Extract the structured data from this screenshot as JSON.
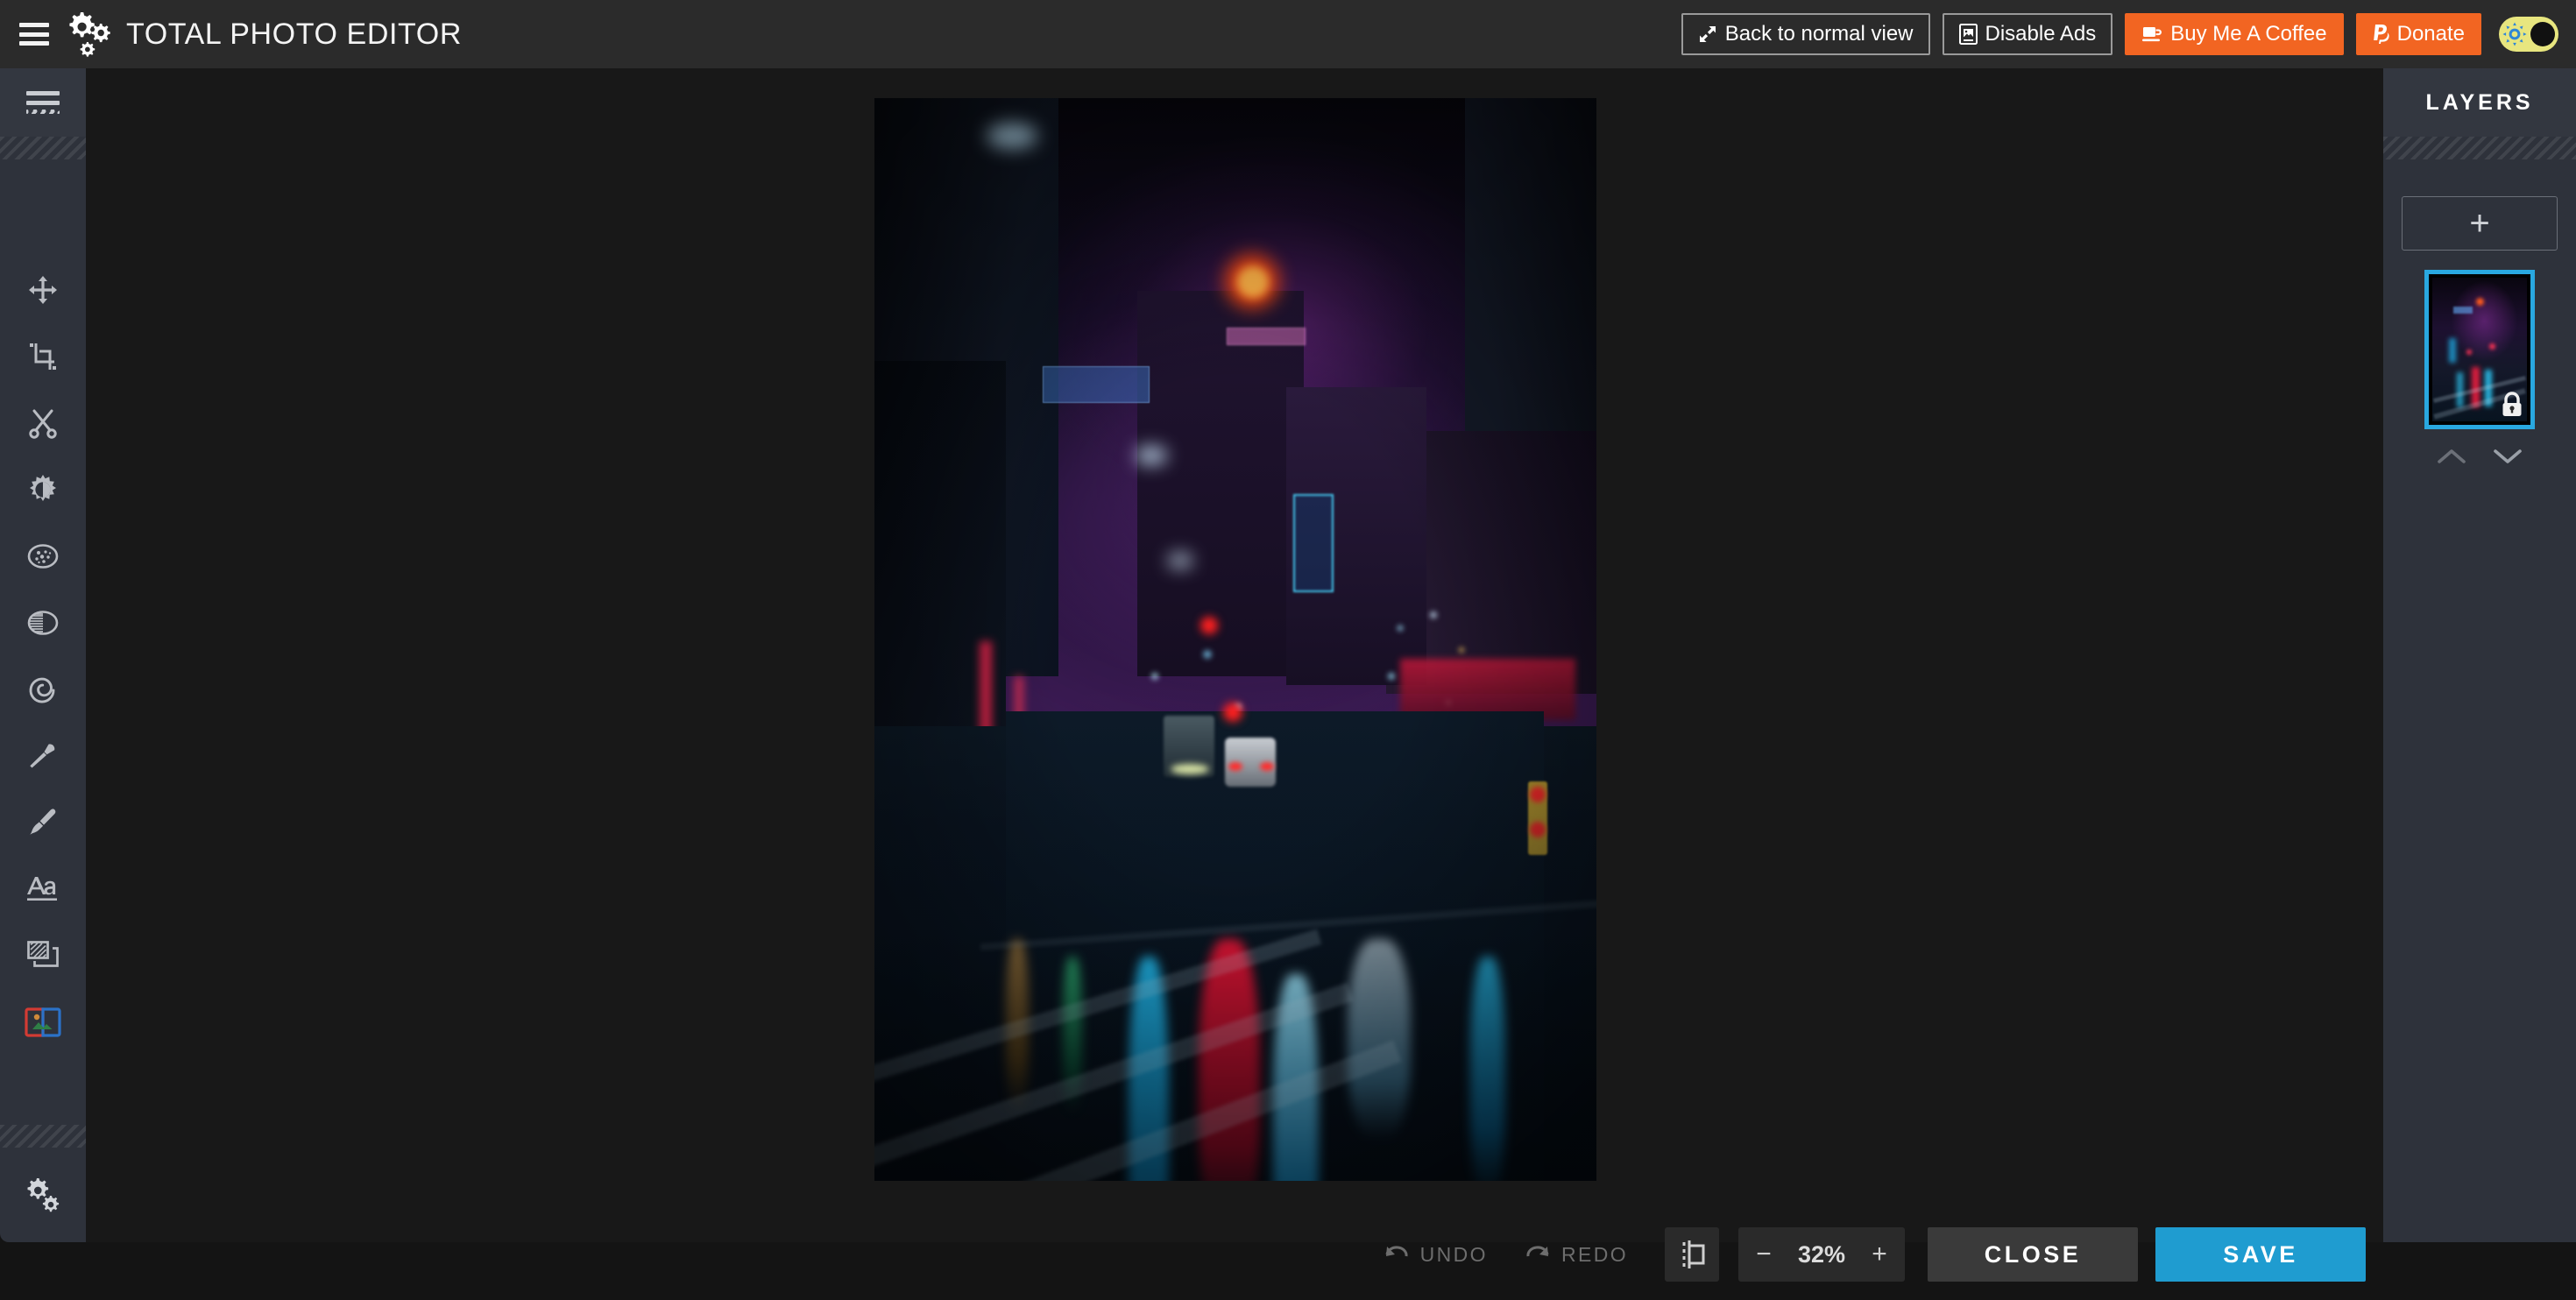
{
  "app": {
    "title": "TOTAL PHOTO EDITOR",
    "menu_icon": "hamburger-icon",
    "logo_icon": "gears-logo-icon"
  },
  "topbar": {
    "buttons": [
      {
        "label": "Back to normal view",
        "icon": "expand-arrows-icon",
        "style": "outline"
      },
      {
        "label": "Disable Ads",
        "icon": "ad-image-icon",
        "style": "outline"
      },
      {
        "label": "Buy Me A Coffee",
        "icon": "coffee-cup-icon",
        "style": "orange"
      },
      {
        "label": "Donate",
        "icon": "paypal-icon",
        "style": "orange"
      }
    ],
    "theme_toggle": {
      "name": "theme-toggle",
      "state": "light",
      "track_color": "#e8e67f",
      "sun_color": "#2f86d6",
      "knob_color": "#111111"
    }
  },
  "left_toolbar": {
    "menu_icon": "list-menu-icon",
    "tools": [
      {
        "name": "move-tool",
        "label": "Move",
        "active": false
      },
      {
        "name": "crop-tool",
        "label": "Crop",
        "active": false
      },
      {
        "name": "cut-tool",
        "label": "Cut",
        "active": false
      },
      {
        "name": "brightness-tool",
        "label": "Brightness",
        "active": false
      },
      {
        "name": "noise-tool",
        "label": "Noise",
        "active": false
      },
      {
        "name": "gradient-tool",
        "label": "Gradient",
        "active": false
      },
      {
        "name": "swirl-tool",
        "label": "Swirl",
        "active": false
      },
      {
        "name": "blur-tool",
        "label": "Blur",
        "active": false
      },
      {
        "name": "paint-tool",
        "label": "Paint Brush",
        "active": false
      },
      {
        "name": "text-tool",
        "label": "Text",
        "active": false
      },
      {
        "name": "frame-tool",
        "label": "Frames",
        "active": false
      },
      {
        "name": "image-tool",
        "label": "Image",
        "active": true
      }
    ],
    "settings_icon": "gears-settings-icon"
  },
  "layers_panel": {
    "title": "LAYERS",
    "add_button": {
      "label": "+",
      "name": "add-layer-button"
    },
    "selected_border_color": "#29a8e0",
    "items": [
      {
        "name": "layer-1",
        "locked": true,
        "selected": true,
        "lock_icon": "lock-icon"
      }
    ],
    "move_up_icon": "chevron-up-icon",
    "move_down_icon": "chevron-down-icon"
  },
  "canvas": {
    "image_alt": "Neon-lit rainy night city street with reflections",
    "background_color": "#181818"
  },
  "bottombar": {
    "undo": {
      "label": "UNDO",
      "icon": "undo-arrow-icon",
      "disabled": true
    },
    "redo": {
      "label": "REDO",
      "icon": "redo-arrow-icon",
      "disabled": true
    },
    "fit_button": {
      "name": "fit-to-screen-button",
      "icon": "fit-frame-icon"
    },
    "zoom": {
      "minus_label": "−",
      "value": "32%",
      "plus_label": "+"
    },
    "close_label": "CLOSE",
    "save_label": "SAVE",
    "save_color": "#1f9cd0"
  }
}
